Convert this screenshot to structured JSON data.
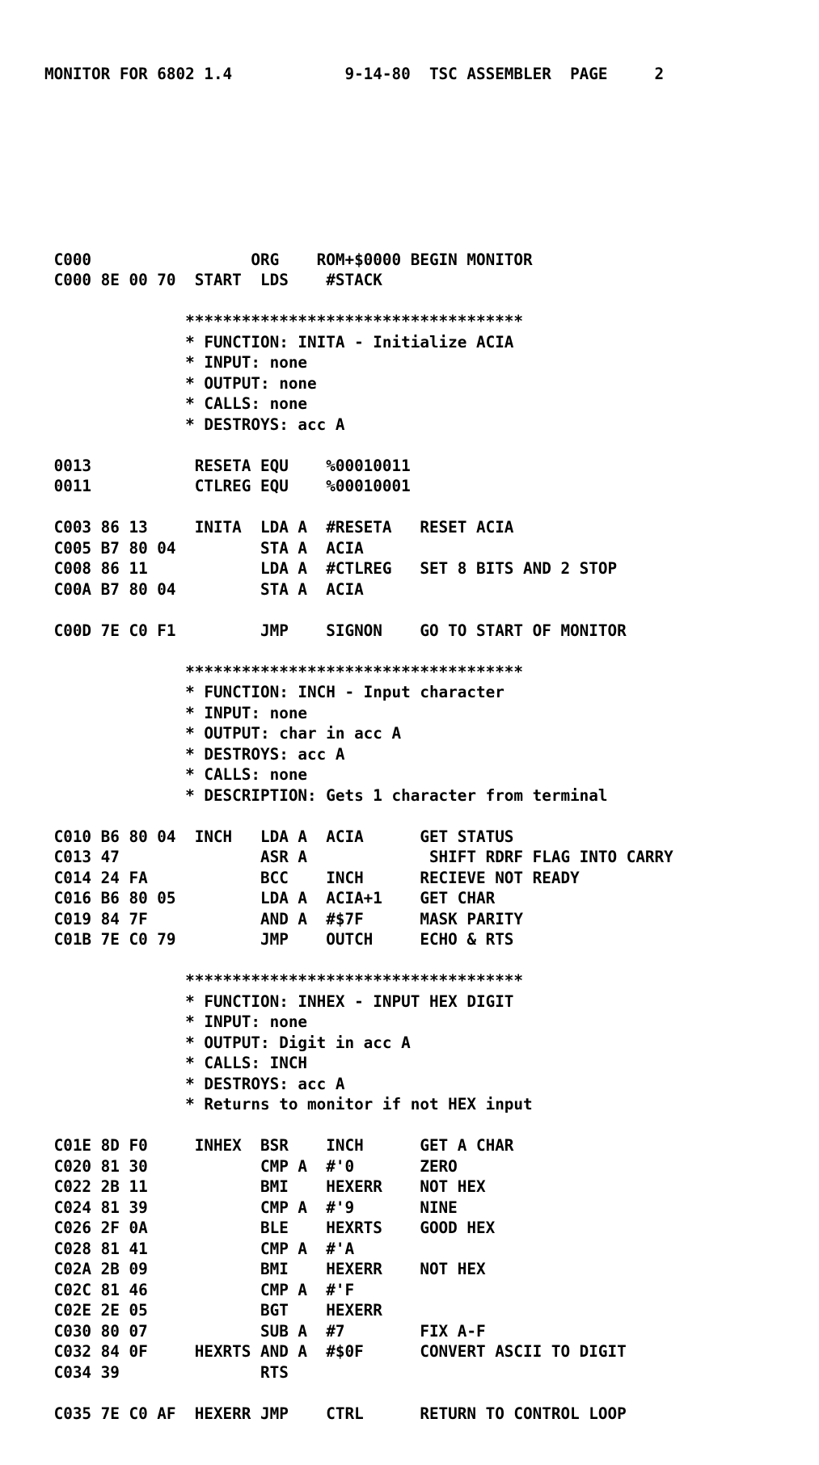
{
  "document": {
    "kind": "assembler-listing",
    "header": {
      "title": "MONITOR FOR 6802 1.4",
      "date": "9-14-80",
      "assembler": "TSC ASSEMBLER",
      "page_label": "PAGE",
      "page_number": "2",
      "text": "MONITOR FOR 6802 1.4            9-14-80  TSC ASSEMBLER  PAGE     2"
    },
    "columns": {
      "address_and_object_code": 1,
      "label": 14,
      "opcode": 22,
      "operand": 28,
      "comment": 37
    },
    "separator_rule": "***********************************",
    "lines": [
      " C000                 ORG    ROM+$0000 BEGIN MONITOR",
      " C000 8E 00 70  START  LDS    #STACK",
      "",
      "               ************************************",
      "               * FUNCTION: INITA - Initialize ACIA",
      "               * INPUT: none",
      "               * OUTPUT: none",
      "               * CALLS: none",
      "               * DESTROYS: acc A",
      "",
      " 0013           RESETA EQU    %00010011",
      " 0011           CTLREG EQU    %00010001",
      "",
      " C003 86 13     INITA  LDA A  #RESETA   RESET ACIA",
      " C005 B7 80 04         STA A  ACIA",
      " C008 86 11            LDA A  #CTLREG   SET 8 BITS AND 2 STOP",
      " C00A B7 80 04         STA A  ACIA",
      "",
      " C00D 7E C0 F1         JMP    SIGNON    GO TO START OF MONITOR",
      "",
      "               ************************************",
      "               * FUNCTION: INCH - Input character",
      "               * INPUT: none",
      "               * OUTPUT: char in acc A",
      "               * DESTROYS: acc A",
      "               * CALLS: none",
      "               * DESCRIPTION: Gets 1 character from terminal",
      "",
      " C010 B6 80 04  INCH   LDA A  ACIA      GET STATUS",
      " C013 47               ASR A             SHIFT RDRF FLAG INTO CARRY",
      " C014 24 FA            BCC    INCH      RECIEVE NOT READY",
      " C016 B6 80 05         LDA A  ACIA+1    GET CHAR",
      " C019 84 7F            AND A  #$7F      MASK PARITY",
      " C01B 7E C0 79         JMP    OUTCH     ECHO & RTS",
      "",
      "               ************************************",
      "               * FUNCTION: INHEX - INPUT HEX DIGIT",
      "               * INPUT: none",
      "               * OUTPUT: Digit in acc A",
      "               * CALLS: INCH",
      "               * DESTROYS: acc A",
      "               * Returns to monitor if not HEX input",
      "",
      " C01E 8D F0     INHEX  BSR    INCH      GET A CHAR",
      " C020 81 30            CMP A  #'0       ZERO",
      " C022 2B 11            BMI    HEXERR    NOT HEX",
      " C024 81 39            CMP A  #'9       NINE",
      " C026 2F 0A            BLE    HEXRTS    GOOD HEX",
      " C028 81 41            CMP A  #'A",
      " C02A 2B 09            BMI    HEXERR    NOT HEX",
      " C02C 81 46            CMP A  #'F",
      " C02E 2E 05            BGT    HEXERR",
      " C030 80 07            SUB A  #7        FIX A-F",
      " C032 84 0F     HEXRTS AND A  #$0F      CONVERT ASCII TO DIGIT",
      " C034 39               RTS",
      "",
      " C035 7E C0 AF  HEXERR JMP    CTRL      RETURN TO CONTROL LOOP"
    ]
  }
}
